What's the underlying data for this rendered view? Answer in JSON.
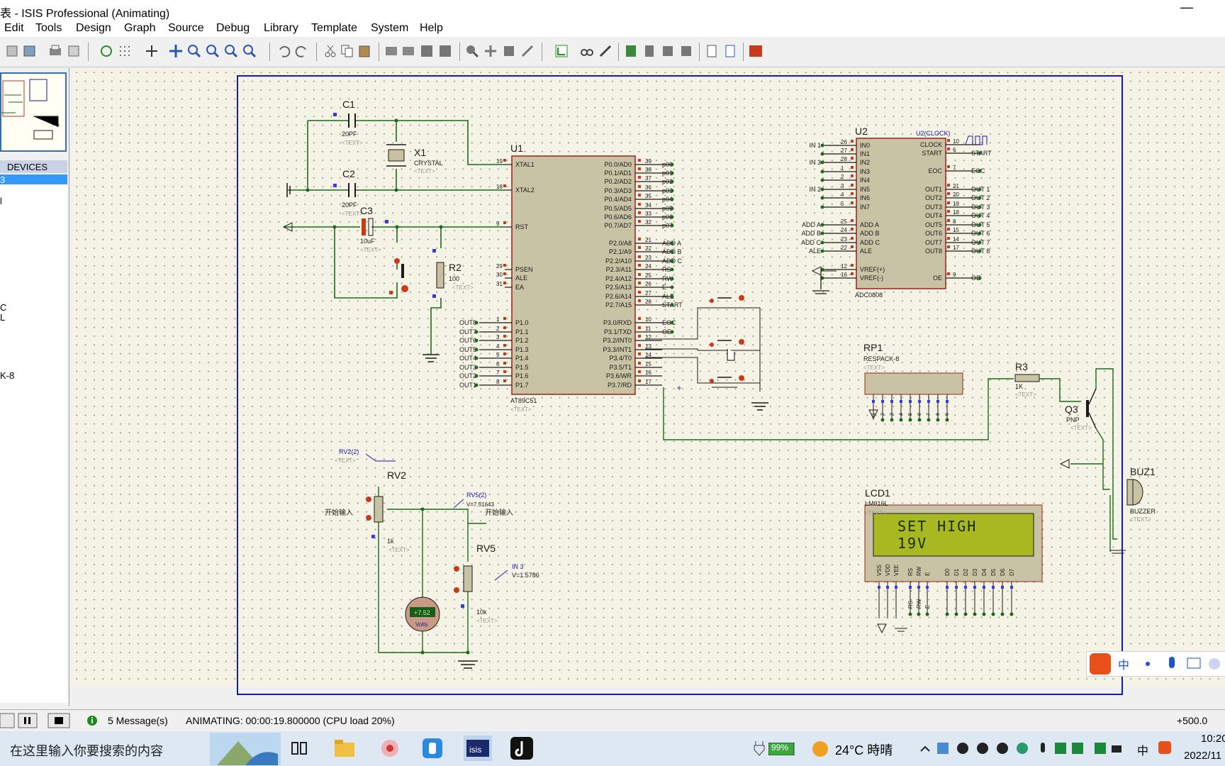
{
  "window": {
    "title": "表 - ISIS Professional (Animating)",
    "minimize_glyph": "—"
  },
  "menu": [
    "Edit",
    "Tools",
    "Design",
    "Graph",
    "Source",
    "Debug",
    "Library",
    "Template",
    "System",
    "Help"
  ],
  "devices": {
    "header": "DEVICES",
    "items": [
      "3",
      "l",
      "C",
      "L",
      "K-8"
    ]
  },
  "schematic": {
    "parts": {
      "c1": {
        "ref": "C1",
        "value": "20PF",
        "text": "<TEXT>"
      },
      "c2": {
        "ref": "C2",
        "value": "20PF",
        "text": "<TEXT>"
      },
      "c3": {
        "ref": "C3",
        "value": "10uF",
        "text": "<TEXT>"
      },
      "x1": {
        "ref": "X1",
        "value": "CRYSTAL",
        "text": "<TEXT>"
      },
      "r2": {
        "ref": "R2",
        "value": "100",
        "text": "<TEXT>"
      },
      "u1": {
        "ref": "U1",
        "value": "AT89C51",
        "text": "<TEXT>"
      },
      "u2": {
        "ref": "U2",
        "value": "ADC0808",
        "clock_label": "U2(CLOCK)"
      },
      "rp1": {
        "ref": "RP1",
        "value": "RESPACK-8",
        "text": "<TEXT>"
      },
      "r3": {
        "ref": "R3",
        "value": "1K",
        "text": "<TEXT>"
      },
      "q3": {
        "ref": "Q3",
        "value": "PNP",
        "text": "<TEXT>"
      },
      "buz1": {
        "ref": "BUZ1",
        "value": "BUZZER",
        "text": "<TEXT>"
      },
      "lcd1": {
        "ref": "LCD1",
        "value": "LM016L",
        "text": "<TEXT>"
      },
      "rv2": {
        "ref": "RV2",
        "value": "1k",
        "probe": "RV2(2)",
        "input": "开始输入",
        "text": "<TEXT>"
      },
      "rv5": {
        "ref": "RV5",
        "value": "10k",
        "probe": "RV5(2)",
        "probe_v": "V=7.51643",
        "input": "开始输入",
        "text": "<TEXT>"
      },
      "in3": {
        "label": "IN 3",
        "v": "V=1.5786"
      },
      "voltmeter": {
        "reading": "+7.52",
        "unit": "Volts"
      }
    },
    "u1_pins": {
      "left": [
        {
          "num": "19",
          "name": "XTAL1"
        },
        {
          "num": "18",
          "name": "XTAL2"
        },
        {
          "num": "9",
          "name": "RST"
        },
        {
          "num": "29",
          "name": "PSEN"
        },
        {
          "num": "30",
          "name": "ALE"
        },
        {
          "num": "31",
          "name": "EA"
        },
        {
          "num": "1",
          "name": "P1.0",
          "net": "OUT8"
        },
        {
          "num": "2",
          "name": "P1.1",
          "net": "OUT7"
        },
        {
          "num": "3",
          "name": "P1.2",
          "net": "OUT6"
        },
        {
          "num": "4",
          "name": "P1.3",
          "net": "OUT5"
        },
        {
          "num": "5",
          "name": "P1.4",
          "net": "OUT4"
        },
        {
          "num": "6",
          "name": "P1.5",
          "net": "OUT3"
        },
        {
          "num": "7",
          "name": "P1.6",
          "net": "OUT2"
        },
        {
          "num": "8",
          "name": "P1.7",
          "net": "OUT1"
        }
      ],
      "right": [
        {
          "num": "39",
          "name": "P0.0/AD0",
          "net": "p00"
        },
        {
          "num": "38",
          "name": "P0.1/AD1",
          "net": "p01"
        },
        {
          "num": "37",
          "name": "P0.2/AD2",
          "net": "p02"
        },
        {
          "num": "36",
          "name": "P0.3/AD3",
          "net": "p03"
        },
        {
          "num": "35",
          "name": "P0.4/AD4",
          "net": "p04"
        },
        {
          "num": "34",
          "name": "P0.5/AD5",
          "net": "p05"
        },
        {
          "num": "33",
          "name": "P0.6/AD6",
          "net": "p06"
        },
        {
          "num": "32",
          "name": "P0.7/AD7",
          "net": "p07"
        },
        {
          "num": "21",
          "name": "P2.0/A8",
          "net": "ADD A"
        },
        {
          "num": "22",
          "name": "P2.1/A9",
          "net": "ADD B"
        },
        {
          "num": "23",
          "name": "P2.2/A10",
          "net": "ADD C"
        },
        {
          "num": "24",
          "name": "P2.3/A11",
          "net": "RS"
        },
        {
          "num": "25",
          "name": "P2.4/A12",
          "net": "RW"
        },
        {
          "num": "26",
          "name": "P2.5/A13",
          "net": "E"
        },
        {
          "num": "27",
          "name": "P2.6/A14",
          "net": "ALE"
        },
        {
          "num": "28",
          "name": "P2.7/A15",
          "net": "START"
        },
        {
          "num": "10",
          "name": "P3.0/RXD",
          "net": "EOC"
        },
        {
          "num": "11",
          "name": "P3.1/TXD",
          "net": "OE"
        },
        {
          "num": "12",
          "name": "P3.2/INT0",
          "net": ""
        },
        {
          "num": "13",
          "name": "P3.3/INT1",
          "net": ""
        },
        {
          "num": "14",
          "name": "P3.4/T0",
          "net": ""
        },
        {
          "num": "15",
          "name": "P3.5/T1",
          "net": ""
        },
        {
          "num": "16",
          "name": "P3.6/WR",
          "net": ""
        },
        {
          "num": "17",
          "name": "P3.7/RD",
          "net": ""
        }
      ]
    },
    "u2_pins": {
      "left": [
        {
          "num": "26",
          "name": "IN0",
          "net": "IN 1"
        },
        {
          "num": "27",
          "name": "IN1",
          "net": ""
        },
        {
          "num": "28",
          "name": "IN2",
          "net": "IN 3"
        },
        {
          "num": "1",
          "name": "IN3",
          "net": ""
        },
        {
          "num": "2",
          "name": "IN4",
          "net": ""
        },
        {
          "num": "3",
          "name": "IN5",
          "net": "IN 2"
        },
        {
          "num": "4",
          "name": "IN6",
          "net": ""
        },
        {
          "num": "5",
          "name": "IN7",
          "net": ""
        },
        {
          "num": "25",
          "name": "ADD A",
          "net": "ADD A"
        },
        {
          "num": "24",
          "name": "ADD B",
          "net": "ADD B"
        },
        {
          "num": "23",
          "name": "ADD C",
          "net": "ADD C"
        },
        {
          "num": "22",
          "name": "ALE",
          "net": "ALE"
        },
        {
          "num": "12",
          "name": "VREF(+)",
          "net": ""
        },
        {
          "num": "16",
          "name": "VREF(-)",
          "net": ""
        }
      ],
      "right": [
        {
          "num": "10",
          "name": "CLOCK",
          "net": ""
        },
        {
          "num": "6",
          "name": "START",
          "net": "START"
        },
        {
          "num": "7",
          "name": "EOC",
          "net": "EOC"
        },
        {
          "num": "21",
          "name": "OUT1",
          "net": "OUT 1"
        },
        {
          "num": "20",
          "name": "OUT2",
          "net": "OUT 2"
        },
        {
          "num": "19",
          "name": "OUT3",
          "net": "OUT 3"
        },
        {
          "num": "18",
          "name": "OUT4",
          "net": "OUT 4"
        },
        {
          "num": "8",
          "name": "OUT5",
          "net": "OUT 5"
        },
        {
          "num": "15",
          "name": "OUT6",
          "net": "OUT 6"
        },
        {
          "num": "14",
          "name": "OUT7",
          "net": "OUT 7"
        },
        {
          "num": "17",
          "name": "OUT8",
          "net": "OUT 8"
        },
        {
          "num": "9",
          "name": "OE",
          "net": "OE"
        }
      ]
    },
    "lcd": {
      "line1": "SET HIGH",
      "line2": "19V",
      "pins": [
        "VSS",
        "VDD",
        "VEE",
        "RS",
        "RW",
        "E",
        "D0",
        "D1",
        "D2",
        "D3",
        "D4",
        "D5",
        "D6",
        "D7"
      ],
      "pin_nets": [
        "RS",
        "RW",
        "E"
      ]
    },
    "rp1_pins": [
      "1",
      "2",
      "3",
      "4",
      "5",
      "6",
      "7",
      "8",
      "9"
    ]
  },
  "status": {
    "messages": "5 Message(s)",
    "animation": "ANIMATING: 00:00:19.800000 (CPU load 20%)",
    "coord": "+500.0"
  },
  "ime": {
    "mode": "中"
  },
  "taskbar": {
    "search_placeholder": "在这里输入你要搜索的内容",
    "battery": "99%",
    "weather": "24°C 時晴",
    "time": "10:20",
    "date": "2022/11",
    "lang": "中"
  }
}
